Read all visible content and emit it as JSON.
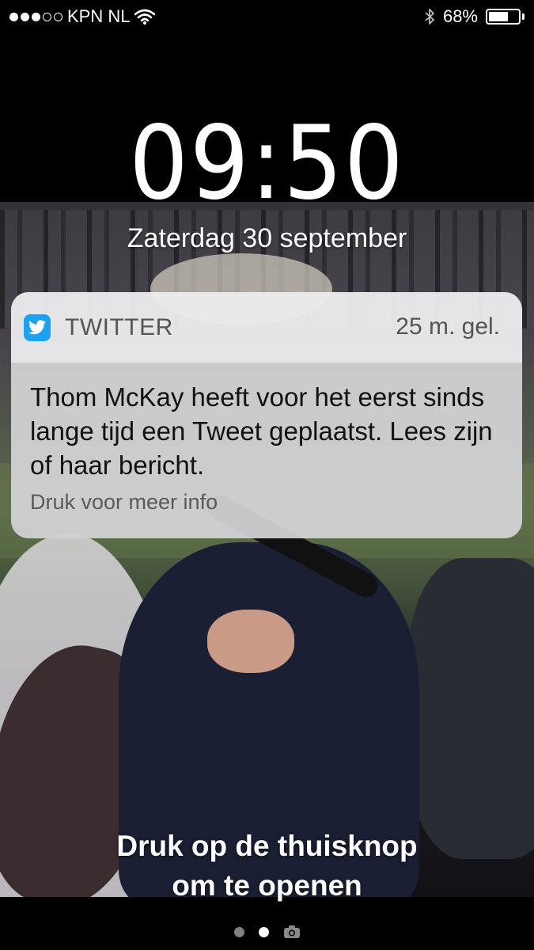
{
  "status_bar": {
    "carrier": "KPN NL",
    "signal_bars_filled": 3,
    "signal_bars_total": 5,
    "battery_percent": "68%",
    "battery_level": 0.68,
    "icons": [
      "signal-dots-icon",
      "wifi-icon",
      "bluetooth-icon",
      "battery-icon"
    ]
  },
  "lock_screen": {
    "time": "09:50",
    "date": "Zaterdag 30 september",
    "unlock_hint_line1": "Druk op de thuisknop",
    "unlock_hint_line2": "om te openen"
  },
  "notification": {
    "app_name": "TWITTER",
    "app_icon": "twitter-bird-icon",
    "app_color": "#1da1f2",
    "time_ago": "25 m. gel.",
    "message": "Thom McKay heeft voor het eerst sinds lange tijd een Tweet geplaatst. Lees zijn of haar bericht.",
    "more_info": "Druk voor meer info"
  },
  "page_indicator": {
    "pages": 3,
    "active_index": 1,
    "last_icon": "camera-icon"
  }
}
